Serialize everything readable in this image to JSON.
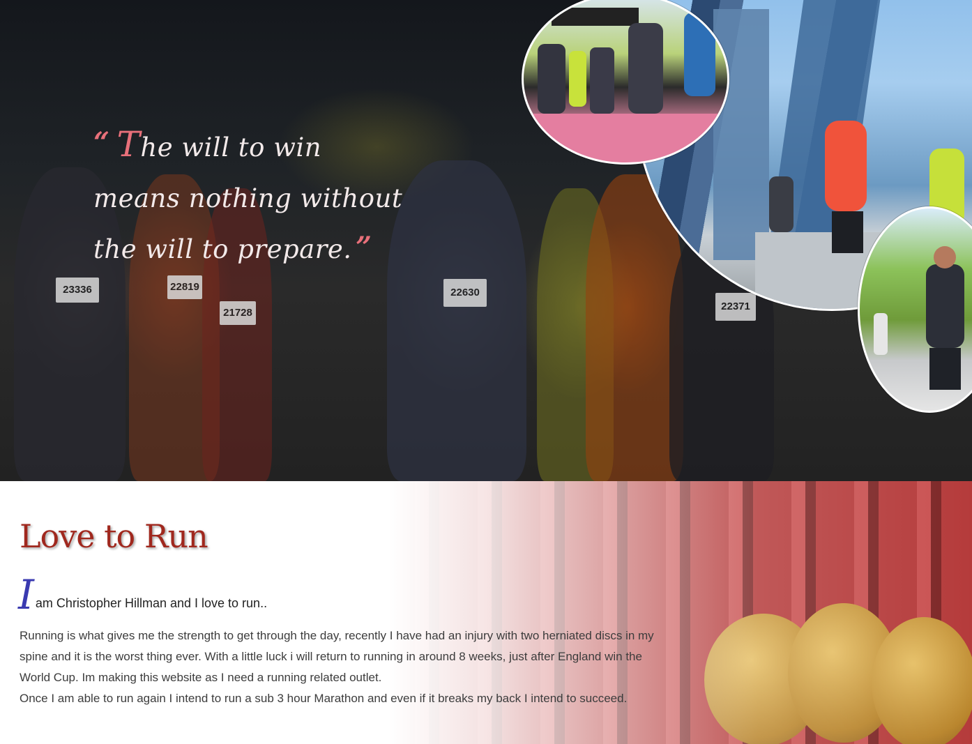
{
  "hero": {
    "quote_open_mark": "“",
    "quote_first_letter": "T",
    "quote_rest_line1": "he will to win",
    "quote_line2": "means nothing without",
    "quote_line3": "the will to prepare.",
    "quote_close_mark": "”",
    "bibs": [
      "23336",
      "22819",
      "21728",
      "22630",
      "22371"
    ],
    "images": [
      {
        "name": "marathon-finish-line-photo"
      },
      {
        "name": "skyscraper-runners-photo"
      },
      {
        "name": "runner-park-photo"
      }
    ]
  },
  "about": {
    "title": "Love to Run",
    "intro_dropcap": "I",
    "intro_text": "am Christopher Hillman and I love to run..",
    "paragraph1": "Running is what gives me the strength to get through the day, recently I have had an injury with two herniated discs in my spine and it is the worst thing ever. With a little luck i will return to running in around 8 weeks, just after England win the World Cup. Im making this website as I need a running related outlet.",
    "paragraph2": "Once I am able to run again I intend to run a sub 3 hour Marathon and even if it breaks my back I intend to succeed."
  },
  "colors": {
    "accent_pink": "#e8707a",
    "title_red": "#a0281e",
    "dropcap_blue": "#3a3ab0"
  }
}
